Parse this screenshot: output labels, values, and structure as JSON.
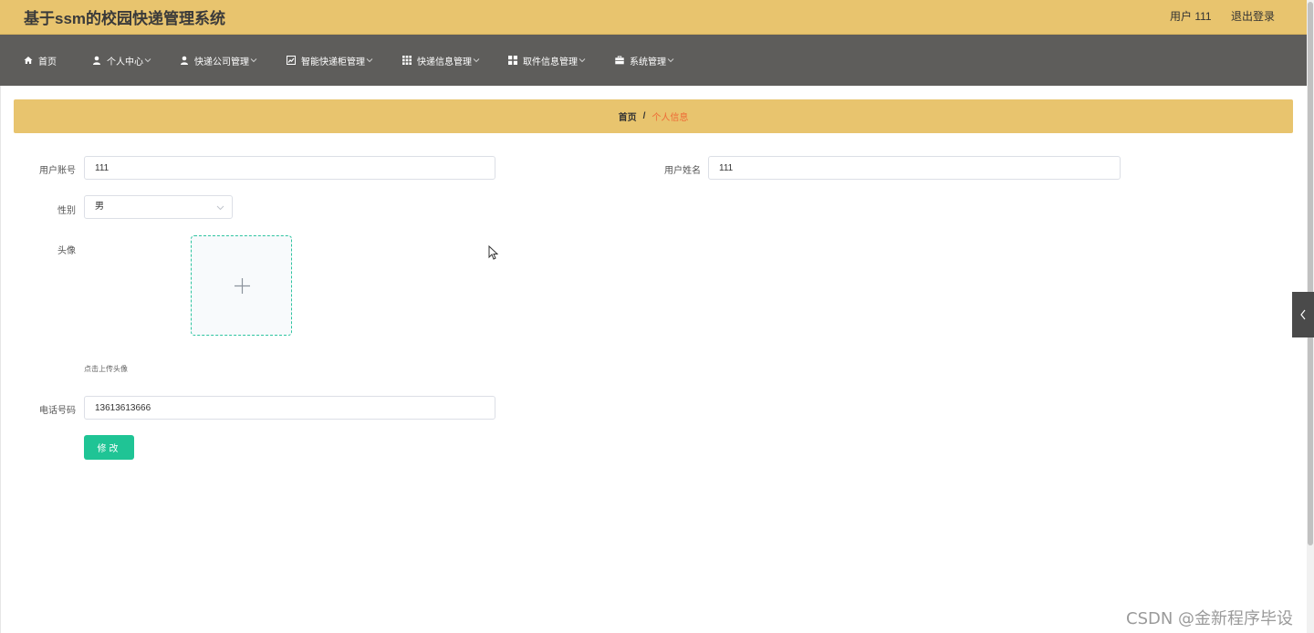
{
  "header": {
    "title": "基于ssm的校园快递管理系统",
    "user_label": "用户 111",
    "logout_label": "退出登录"
  },
  "nav": {
    "items": [
      {
        "label": "首页",
        "icon": "home-icon"
      },
      {
        "label": "个人中心",
        "icon": "user-icon"
      },
      {
        "label": "快递公司管理",
        "icon": "user-icon"
      },
      {
        "label": "智能快递柜管理",
        "icon": "chart-icon"
      },
      {
        "label": "快递信息管理",
        "icon": "grid-icon"
      },
      {
        "label": "取件信息管理",
        "icon": "apps-icon"
      },
      {
        "label": "系统管理",
        "icon": "briefcase-icon"
      }
    ]
  },
  "breadcrumb": {
    "home": "首页",
    "separator": "/",
    "current": "个人信息"
  },
  "form": {
    "account_label": "用户账号",
    "account_value": "111",
    "name_label": "用户姓名",
    "name_value": "111",
    "gender_label": "性别",
    "gender_value": "男",
    "avatar_label": "头像",
    "avatar_tip": "点击上传头像",
    "phone_label": "电话号码",
    "phone_value": "13613613666",
    "submit_label": "修改"
  },
  "watermark": "CSDN @金新程序毕设",
  "colors": {
    "header_bg": "#e8c46e",
    "nav_bg": "#5e5d5b",
    "accent": "#1fc495",
    "breadcrumb_current": "#ee6a35"
  }
}
